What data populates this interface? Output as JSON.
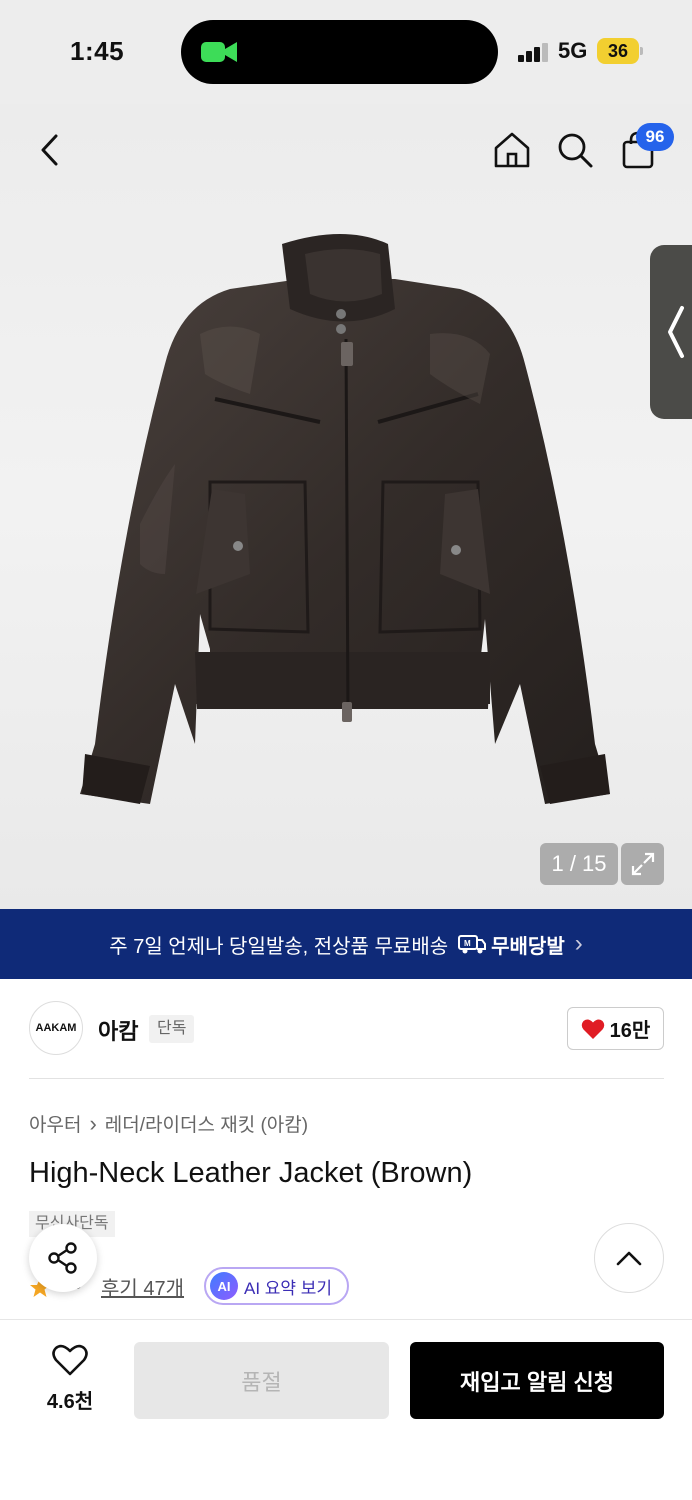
{
  "status_bar": {
    "time": "1:45",
    "network": "5G",
    "battery": "36"
  },
  "header": {
    "back_icon": "chevron-left-icon",
    "home_icon": "home-icon",
    "search_icon": "search-icon",
    "cart_icon": "shopping-bag-icon",
    "cart_badge": "96"
  },
  "gallery": {
    "counter": "1 / 15",
    "expand_icon": "expand-icon"
  },
  "banner": {
    "text": "주 7일 언제나 당일발송, 전상품 무료배송",
    "logo_text": "무배당발",
    "arrow": "›"
  },
  "brand": {
    "logo_text": "AAKAM",
    "name": "아캄",
    "tag": "단독",
    "likes": "16만"
  },
  "breadcrumb": {
    "category": "아우터",
    "separator": "›",
    "subcategory": "레더/라이더스 재킷 (아캄)"
  },
  "product": {
    "title": "High-Neck Leather Jacket (Brown)",
    "exclusive_tag": "무신사단독",
    "rating": ".9",
    "reviews": "후기 47개",
    "ai_chip": "AI",
    "ai_summary": "AI 요약 보기"
  },
  "bottom_bar": {
    "wish_count": "4.6천",
    "soldout_label": "품절",
    "restock_label": "재입고 알림 신청"
  },
  "colors": {
    "banner_bg": "#0f2a78",
    "badge": "#2563eb",
    "heart": "#e01c24",
    "primary_button": "#000000"
  }
}
